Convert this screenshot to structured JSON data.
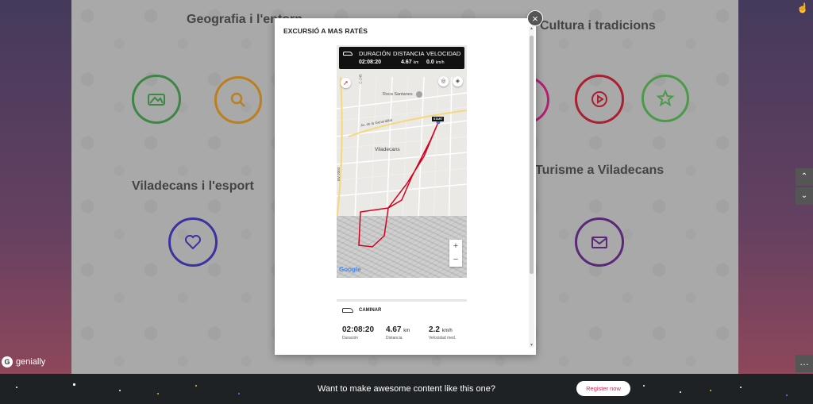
{
  "sections": {
    "geografia": "Geografia i l'entorn",
    "cultura": "Cultura i tradicions",
    "esport": "Viladecans i l'esport",
    "turisme": "Turisme a Viladecans"
  },
  "modal": {
    "title": "EXCURSIÓ A MAS RATÉS",
    "close_label": "×",
    "map": {
      "header": {
        "duration_label": "DURACIÓN",
        "distance_label": "DISTANCIA",
        "speed_label": "VELOCIDAD",
        "duration_value": "02:08:20",
        "distance_value": "4.67",
        "distance_unit": "km",
        "speed_value": "0.0",
        "speed_unit": "km/h"
      },
      "labels": {
        "roca": "Roca Santanes",
        "viladecans": "Viladecans",
        "av_generalitat": "Av. de la Generalitat",
        "start": "START",
        "bv": "BV-2003",
        "c245": "C-245"
      },
      "zoom_in": "+",
      "zoom_out": "−",
      "attribution": "Google"
    },
    "activity": {
      "type": "CAMINAR",
      "duration_value": "02:08:20",
      "duration_label": "Duración",
      "distance_value": "4.67",
      "distance_unit": "km",
      "distance_label": "Distancia",
      "speed_value": "2.2",
      "speed_unit": "km/h",
      "speed_label": "Velocidad med."
    }
  },
  "brand": {
    "name": "genially",
    "logo_letter": "G"
  },
  "footer": {
    "cta_text": "Want to make awesome content like this one?",
    "register_label": "Register now"
  },
  "colors": {
    "geografia_green": "#2e9e3b",
    "geografia_orange": "#f29400",
    "cultura_pink": "#e5007e",
    "cultura_red": "#d6001c",
    "cultura_lightgreen": "#44bd43",
    "esport_blue": "#2c1ec7",
    "turisme_purple": "#5b0f8b",
    "route_red": "#d6001c",
    "register_text": "#e0245e"
  }
}
